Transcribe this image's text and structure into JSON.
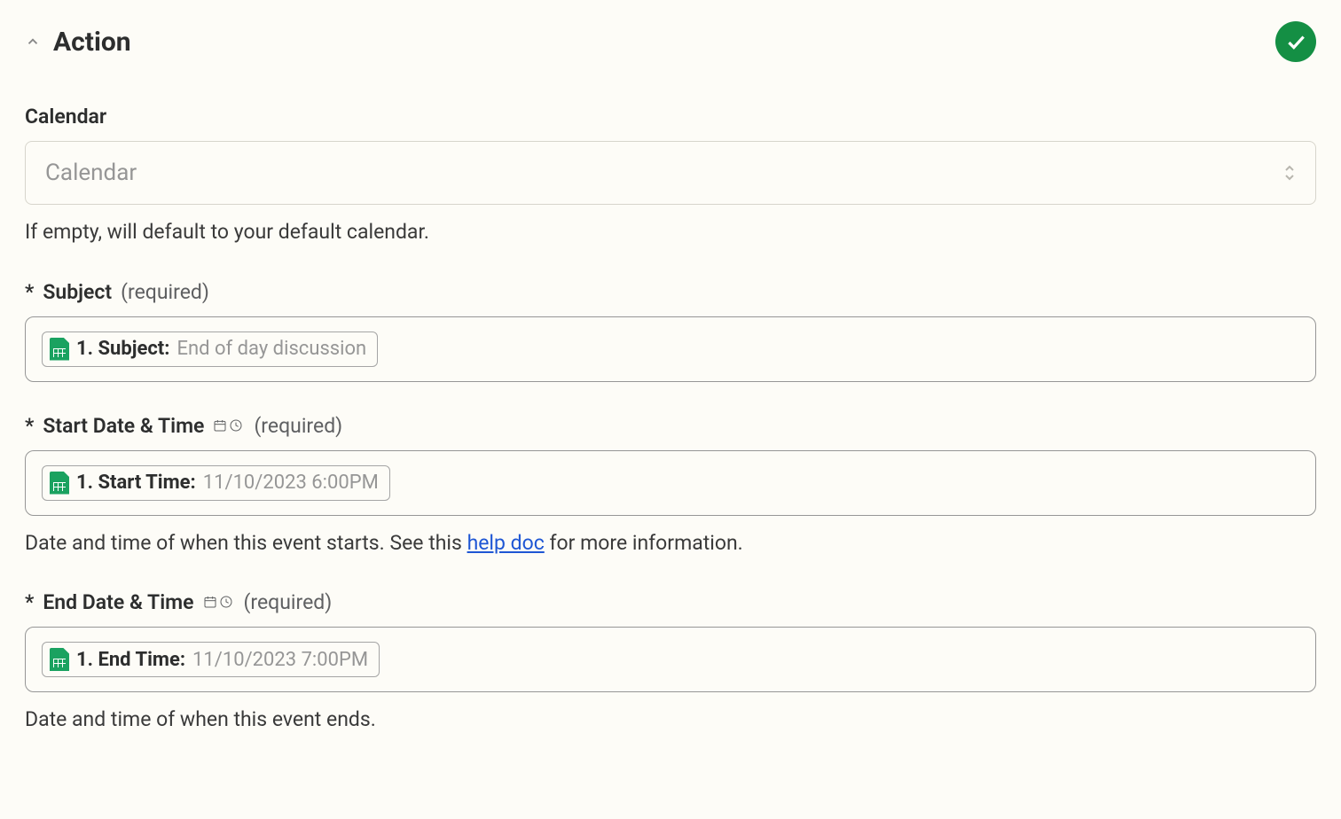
{
  "section": {
    "title": "Action"
  },
  "fields": {
    "calendar": {
      "label": "Calendar",
      "placeholder": "Calendar",
      "helper": "If empty, will default to your default calendar."
    },
    "subject": {
      "required_star": "*",
      "label": "Subject",
      "required_tag": "(required)",
      "pill_label": "1. Subject: ",
      "pill_value": "End of day discussion"
    },
    "start": {
      "required_star": "*",
      "label": "Start Date & Time",
      "required_tag": "(required)",
      "pill_label": "1. Start Time: ",
      "pill_value": "11/10/2023 6:00PM",
      "helper_prefix": "Date and time of when this event starts. See this ",
      "helper_link": "help doc",
      "helper_suffix": " for more information."
    },
    "end": {
      "required_star": "*",
      "label": "End Date & Time",
      "required_tag": "(required)",
      "pill_label": "1. End Time: ",
      "pill_value": "11/10/2023 7:00PM",
      "helper": "Date and time of when this event ends."
    }
  }
}
